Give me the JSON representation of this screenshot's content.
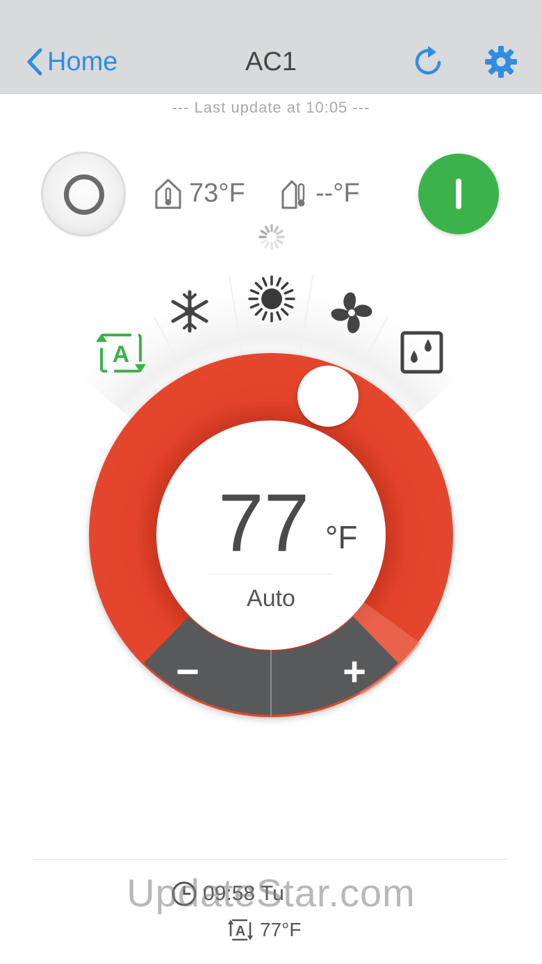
{
  "nav": {
    "back_label": "Home",
    "title": "AC1",
    "accent_color": "#2f8de4"
  },
  "last_update": "--- Last update at 10:05 ---",
  "power": {
    "off_icon": "power-off-ring-icon",
    "on_icon": "power-on-bar-icon",
    "on_color": "#3cb34a",
    "state": "on"
  },
  "indoor_temp": "73°F",
  "outdoor_temp": "--°F",
  "modes": {
    "items": [
      "auto",
      "cool",
      "heat",
      "fan",
      "dry"
    ],
    "selected": "auto",
    "selected_color": "#3cb34a"
  },
  "dial": {
    "setpoint": "77",
    "unit": "°F",
    "mode_label": "Auto",
    "ring_color": "#e2432a",
    "controls_color": "#58595b",
    "minus_label": "−",
    "plus_label": "+"
  },
  "schedule": {
    "time": "09:58 Tu",
    "temp": "77°F"
  },
  "watermark": "UpdateStar.com"
}
